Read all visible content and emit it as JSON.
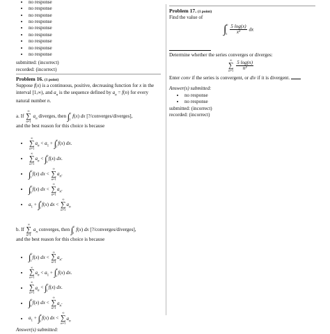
{
  "left": {
    "no_response_items": [
      "no response",
      "no response",
      "no response",
      "no response",
      "no response",
      "no response",
      "no response",
      "no response",
      "no response"
    ],
    "submitted": "submitted: (incorrect)",
    "recorded": "recorded: (incorrect)",
    "problem16": {
      "title": "Problem 16.",
      "points": "(1 point)",
      "intro": "Suppose f(x) is a continuous, positive, decreasing function for x in the interval [1,∞), and a_n is the sequence defined by a_n = f(n) for every natural number n.",
      "part_a_label": "a.",
      "part_a_text_1": "If",
      "part_a_text_2": "diverges, then",
      "part_a_text_3": "f(x) dx",
      "part_a_choice": "[?/converges/diverges],",
      "part_a_reason": "and the best reason for this choice is because",
      "part_b_label": "b.",
      "part_b_text_1": "If",
      "part_b_text_2": "converges, then",
      "part_b_choice": "[?/converges/diverges],",
      "part_b_reason": "and the best reason for this choice is because",
      "answers_submitted": "Answer(s) submitted:"
    }
  },
  "right": {
    "problem17": {
      "title": "Problem 17.",
      "points": "(1 point)",
      "find_value": "Find the value of",
      "integrand_num": "5 log(x)",
      "integrand_den": "x²",
      "determine": "Determine whether the series converges or diverges:",
      "series_num": "5 log(n)",
      "series_den": "n²",
      "enter_text_1": "Enter",
      "enter_conv": "conv",
      "enter_text_2": "if the series is convergent, or",
      "enter_div": "div",
      "enter_text_3": "if it is divergent.",
      "answers_submitted": "Answer(s) submitted:",
      "no_response_items": [
        "no response",
        "no response"
      ],
      "submitted": "submitted: (incorrect)",
      "recorded": "recorded: (incorrect)"
    }
  }
}
